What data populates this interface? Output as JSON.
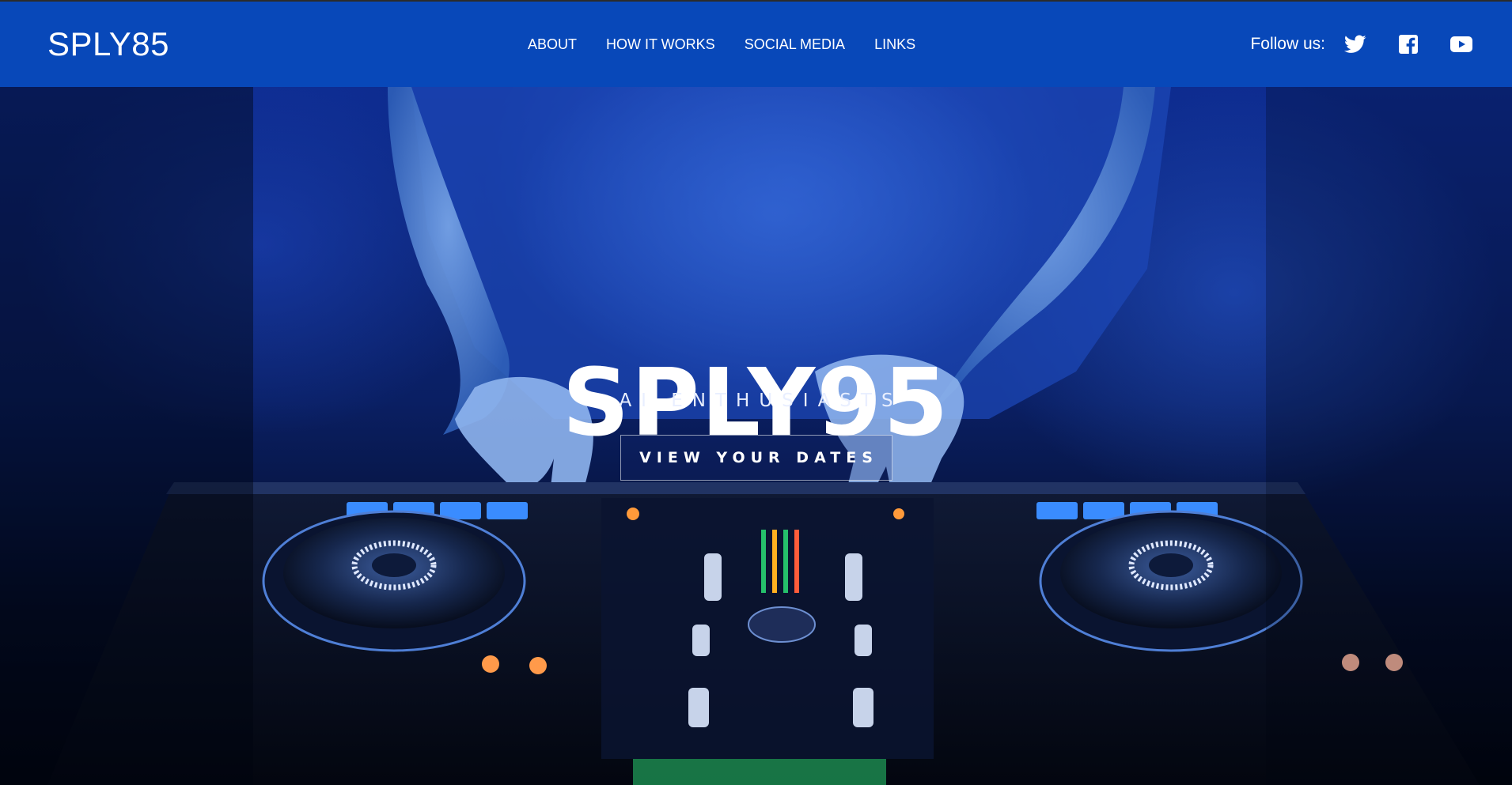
{
  "header": {
    "brand": "SPLY85",
    "nav": [
      "ABOUT",
      "HOW IT WORKS",
      "SOCIAL MEDIA",
      "LINKS"
    ],
    "follow_label": "Follow us:",
    "social_icons": [
      "twitter-icon",
      "facebook-icon",
      "youtube-icon"
    ],
    "background_color": "#0848b9"
  },
  "hero": {
    "title": "SPLY95",
    "subtitle": "AI ENTHUSIASTS",
    "cta_label": "VIEW YOUR DATES",
    "image_subject": "DJ hands on mixing controller in blue smoke"
  },
  "colors": {
    "accent_blue": "#0848b9",
    "text": "#ffffff"
  }
}
